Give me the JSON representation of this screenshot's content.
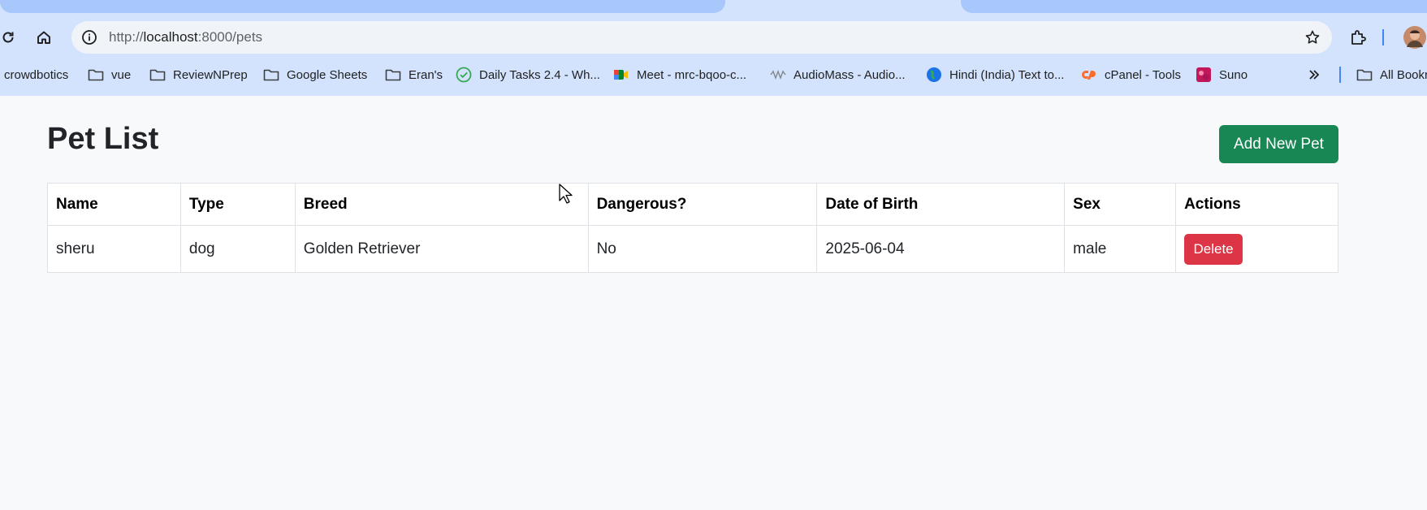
{
  "browser": {
    "url_prefix": "http://",
    "url_host": "localhost",
    "url_rest": ":8000/pets",
    "bookmarks": [
      {
        "label": "crowdbotics",
        "icon": "none"
      },
      {
        "label": "vue",
        "icon": "folder-icon"
      },
      {
        "label": "ReviewNPrep",
        "icon": "folder-icon"
      },
      {
        "label": "Google Sheets",
        "icon": "folder-icon"
      },
      {
        "label": "Eran's",
        "icon": "folder-icon"
      },
      {
        "label": "Daily Tasks 2.4 - Wh...",
        "icon": "check-circle-icon"
      },
      {
        "label": "Meet - mrc-bqoo-c...",
        "icon": "meet-icon"
      },
      {
        "label": "AudioMass - Audio...",
        "icon": "wave-icon"
      },
      {
        "label": "Hindi (India) Text to...",
        "icon": "globe-icon"
      },
      {
        "label": "cPanel - Tools",
        "icon": "cpanel-icon"
      },
      {
        "label": "Suno",
        "icon": "suno-icon"
      }
    ],
    "all_bookmarks_label": "All Bookmarks"
  },
  "page": {
    "title": "Pet List",
    "add_button": "Add New Pet",
    "table": {
      "headers": [
        "Name",
        "Type",
        "Breed",
        "Dangerous?",
        "Date of Birth",
        "Sex",
        "Actions"
      ],
      "rows": [
        {
          "name": "sheru",
          "type": "dog",
          "breed": "Golden Retriever",
          "dangerous": "No",
          "dob": "2025-06-04",
          "sex": "male",
          "action": "Delete"
        }
      ]
    }
  },
  "colors": {
    "primary_success": "#198754",
    "danger": "#dc3545",
    "chrome_bg": "#d3e3fd"
  }
}
